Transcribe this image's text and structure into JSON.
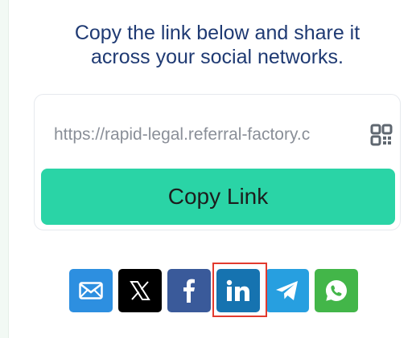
{
  "heading": {
    "line1": "Copy the link below and share it",
    "line2": "across your social networks."
  },
  "link": {
    "url": "https://rapid-legal.referral-factory.c",
    "copy_label": "Copy Link"
  },
  "share": [
    {
      "name": "email",
      "icon": "envelope-icon",
      "color": "#2d8fe0"
    },
    {
      "name": "x",
      "icon": "x-logo-icon",
      "color": "#000000"
    },
    {
      "name": "facebook",
      "icon": "facebook-icon",
      "color": "#3a5a9a"
    },
    {
      "name": "linkedin",
      "icon": "linkedin-icon",
      "color": "#1673b0"
    },
    {
      "name": "telegram",
      "icon": "telegram-icon",
      "color": "#279fe0"
    },
    {
      "name": "whatsapp",
      "icon": "whatsapp-icon",
      "color": "#43b649"
    }
  ],
  "colors": {
    "heading": "#1f3a73",
    "copy_button": "#2ad4a6",
    "highlight": "#e23a2e"
  }
}
